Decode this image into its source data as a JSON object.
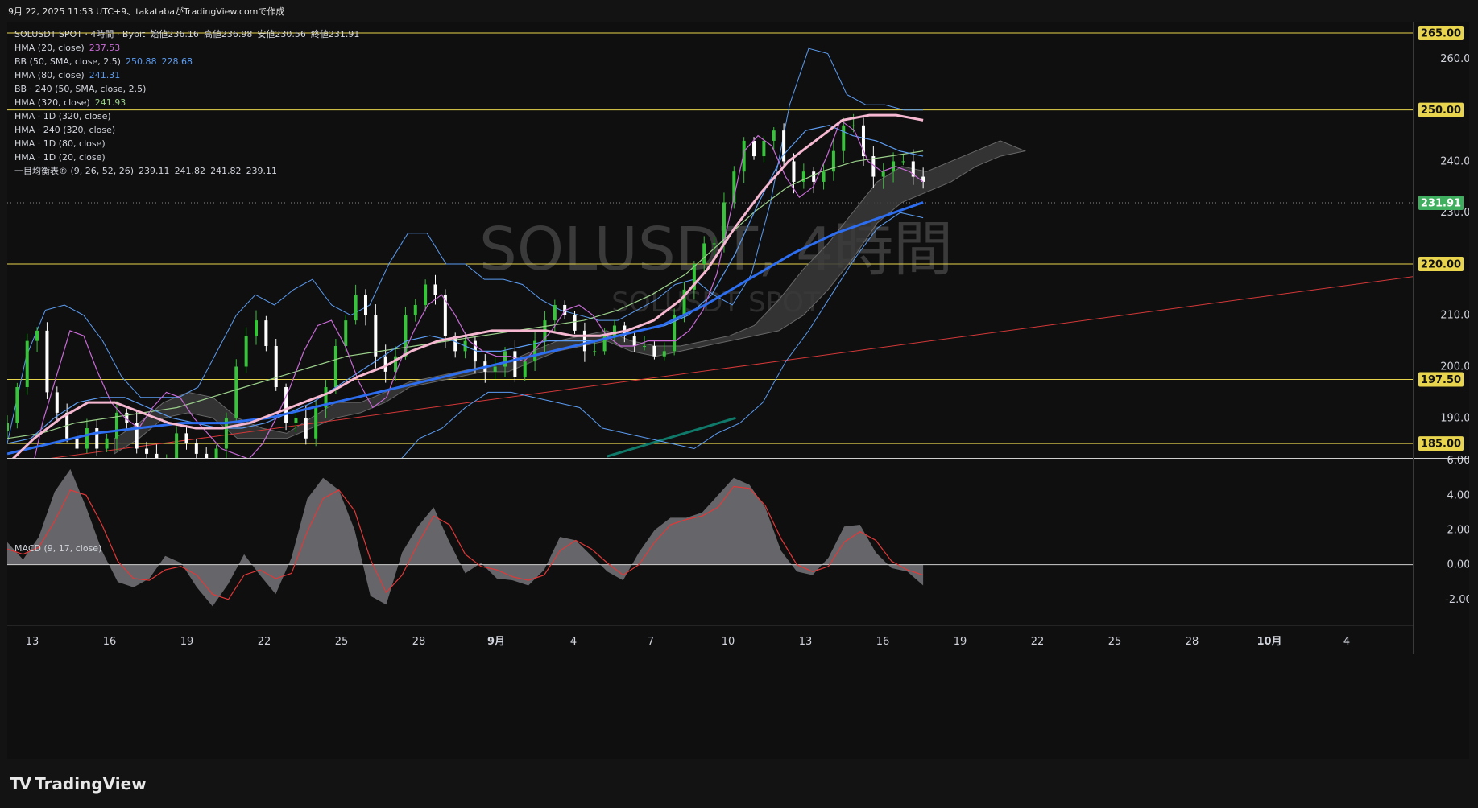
{
  "caption": "9月 22, 2025 11:53 UTC+9、takatabaがTradingView.comで作成",
  "watermark": {
    "main": "SOLUSDT, 4時間",
    "sub": "SOLUSDT SPOT"
  },
  "footer_brand": "TradingView",
  "macd_title": "MACD (9, 17, close)",
  "legend": [
    {
      "label": "SOLUSDT SPOT · 4時間 · Bybit",
      "values": [
        "始値236.16",
        "高値236.98",
        "安値230.56",
        "終値231.91"
      ],
      "color": "#d1d4dc"
    },
    {
      "label": "HMA (20, close)",
      "values": [
        "237.53"
      ],
      "color": "#c86ad6"
    },
    {
      "label": "BB (50, SMA, close, 2.5)",
      "values": [
        "250.88",
        "228.68"
      ],
      "color": "#5b9cf2"
    },
    {
      "label": "HMA (80, close)",
      "values": [
        "241.31"
      ],
      "color": "#5b9cf2"
    },
    {
      "label": "BB · 240 (50, SMA, close, 2.5)",
      "values": [],
      "color": "#d1d4dc"
    },
    {
      "label": "HMA (320, close)",
      "values": [
        "241.93"
      ],
      "color": "#9bd18b"
    },
    {
      "label": "HMA · 1D (320, close)",
      "values": [],
      "color": "#d1d4dc"
    },
    {
      "label": "HMA · 240 (320, close)",
      "values": [],
      "color": "#d1d4dc"
    },
    {
      "label": "HMA · 1D (80, close)",
      "values": [],
      "color": "#d1d4dc"
    },
    {
      "label": "HMA · 1D (20, close)",
      "values": [],
      "color": "#d1d4dc"
    },
    {
      "label": "一目均衡表® (9, 26, 52, 26)",
      "values": [
        "239.11",
        "241.82",
        "241.82",
        "239.11"
      ],
      "color": "#d1d4dc"
    }
  ],
  "chart_data": [
    {
      "type": "line",
      "title": "",
      "price_axis_ticks": [
        260,
        240,
        230,
        210,
        200,
        190
      ],
      "price_labels": [
        {
          "value": 265,
          "text": "265.00",
          "kind": "level"
        },
        {
          "value": 250,
          "text": "250.00",
          "kind": "level"
        },
        {
          "value": 220,
          "text": "220.00",
          "kind": "level"
        },
        {
          "value": 197.5,
          "text": "197.50",
          "kind": "level"
        },
        {
          "value": 185,
          "text": "185.00",
          "kind": "level"
        },
        {
          "value": 231.91,
          "text": "231.91",
          "kind": "last"
        }
      ],
      "ylim": [
        182.2,
        267.2
      ],
      "x_ticks": [
        "13",
        "16",
        "19",
        "22",
        "25",
        "28",
        "9月",
        "4",
        "7",
        "10",
        "13",
        "16",
        "19",
        "22",
        "25",
        "28",
        "10月",
        "4"
      ],
      "colors": {
        "level": "#e8d44d",
        "last": "#3fae5e",
        "up": "#37c43a",
        "down": "#ffffff",
        "bb": "#5b9cf2",
        "hma20": "#c86ad6",
        "hma80": "#5b9cf2",
        "hma320": "#9bd18b",
        "hma_1d_20": "#f5b8d0",
        "hma_1d_80": "#2d6df0",
        "cloud": "#777777",
        "trend": "#d43838",
        "teal": "#0f7a6a"
      },
      "close": [
        189,
        196,
        205,
        207,
        195,
        191,
        186,
        184,
        188,
        184,
        186,
        191,
        189,
        184,
        183,
        181,
        182,
        187,
        185,
        183,
        181,
        184,
        190,
        200,
        206,
        209,
        204,
        196,
        189,
        190,
        186,
        192,
        196,
        204,
        209,
        214,
        210,
        202,
        199,
        202,
        210,
        212,
        216,
        214,
        206,
        203,
        205,
        201,
        199,
        200,
        203,
        198,
        201,
        205,
        209,
        212,
        210,
        207,
        203,
        203,
        206,
        208,
        206,
        204,
        204,
        202,
        203,
        210,
        215,
        220,
        224,
        224,
        232,
        238,
        244,
        241,
        244,
        246,
        240,
        236,
        238,
        236,
        238,
        242,
        247,
        247,
        241,
        237,
        238,
        240,
        240,
        237,
        236
      ],
      "bb_upper": [
        185,
        202,
        211,
        212,
        210,
        205,
        198,
        194,
        194,
        194,
        196,
        203,
        210,
        214,
        212,
        215,
        217,
        212,
        210,
        212,
        220,
        226,
        226,
        220,
        220,
        217,
        217,
        216,
        213,
        211,
        210,
        209,
        209,
        211,
        213,
        216,
        217,
        214,
        212,
        218,
        232,
        251,
        262,
        261,
        253,
        251,
        251,
        250,
        250
      ],
      "bb_lower": [
        177,
        178,
        180,
        179,
        181,
        181,
        180,
        179,
        177,
        175,
        172,
        172,
        171,
        173,
        175,
        178,
        180,
        181,
        186,
        188,
        192,
        195,
        195,
        194,
        193,
        192,
        188,
        187,
        186,
        185,
        184,
        187,
        189,
        193,
        201,
        207,
        214,
        221,
        227,
        230,
        229
      ],
      "hma20": [
        177,
        189,
        198,
        207,
        206,
        199,
        193,
        190,
        188,
        192,
        195,
        194,
        190,
        187,
        184,
        183,
        182,
        185,
        190,
        196,
        203,
        208,
        209,
        204,
        197,
        192,
        194,
        201,
        207,
        212,
        214,
        210,
        205,
        203,
        202,
        202,
        201,
        204,
        207,
        211,
        212,
        210,
        206,
        204,
        204,
        205,
        205,
        205,
        207,
        211,
        218,
        230,
        242,
        245,
        243,
        237,
        233,
        235,
        241,
        248,
        246,
        240,
        238,
        239,
        238,
        236
      ],
      "hma80": [
        185,
        186,
        190,
        193,
        194,
        194,
        192,
        190,
        189,
        188,
        188,
        189,
        191,
        193,
        196,
        199,
        202,
        205,
        206,
        205,
        203,
        203,
        204,
        205,
        205,
        205,
        206,
        207,
        208,
        210,
        214,
        222,
        232,
        241,
        246,
        247,
        245,
        244,
        242,
        241
      ],
      "hma320": [
        186,
        187,
        189,
        190,
        191,
        192,
        194,
        196,
        198,
        200,
        202,
        203,
        204,
        205,
        206,
        207,
        208,
        209,
        211,
        214,
        218,
        224,
        230,
        235,
        238,
        240,
        241,
        242
      ],
      "hma_1d_20": [
        181,
        186,
        190,
        193,
        193,
        191,
        189,
        188,
        188,
        189,
        191,
        193,
        195,
        198,
        200,
        203,
        205,
        206,
        207,
        207,
        207,
        206,
        206,
        207,
        209,
        213,
        219,
        227,
        234,
        240,
        244,
        248,
        249,
        249,
        248
      ],
      "hma_1d_80": [
        183,
        185,
        187,
        188,
        189,
        189,
        190,
        192,
        194,
        196,
        198,
        200,
        202,
        204,
        206,
        208,
        212,
        217,
        222,
        226,
        229,
        232
      ],
      "cloud_a": [
        186,
        189,
        193,
        195,
        194,
        190,
        188,
        187,
        190,
        193,
        193,
        195,
        197,
        198,
        199,
        200,
        201,
        203,
        205,
        206,
        207,
        205,
        204,
        204,
        205,
        206,
        208,
        213,
        219,
        224,
        230,
        236,
        239,
        238,
        240,
        242,
        244,
        242
      ],
      "cloud_b": [
        183,
        186,
        190,
        191,
        190,
        186,
        186,
        186,
        188,
        190,
        191,
        193,
        196,
        197,
        198,
        199,
        199,
        201,
        203,
        204,
        205,
        203,
        202,
        203,
        204,
        205,
        206,
        207,
        210,
        215,
        221,
        228,
        232,
        234,
        236,
        239,
        241,
        242
      ],
      "trend": [
        [
          0,
          181
        ],
        [
          1.76,
          230
        ]
      ],
      "teal": [
        [
          0.56,
          182.5
        ],
        [
          0.68,
          190
        ]
      ]
    },
    {
      "type": "area",
      "title": "MACD (9, 17, close)",
      "y_ticks": [
        6,
        4,
        2,
        0,
        -2
      ],
      "ylim": [
        -3.4,
        6.1
      ],
      "colors": {
        "macd_fill": "#707074",
        "signal": "#e23838",
        "zero": "#cfcfcf"
      },
      "macd": [
        1.3,
        0.3,
        1.6,
        4.2,
        5.5,
        3.3,
        0.8,
        -1.0,
        -1.3,
        -0.8,
        0.5,
        0.1,
        -1.3,
        -2.4,
        -1.1,
        0.6,
        -0.6,
        -1.7,
        0.4,
        3.8,
        5.0,
        4.3,
        2.0,
        -1.8,
        -2.3,
        0.7,
        2.2,
        3.3,
        1.3,
        -0.5,
        0.1,
        -0.8,
        -0.9,
        -1.2,
        -0.3,
        1.6,
        1.4,
        0.5,
        -0.4,
        -0.9,
        0.7,
        2.0,
        2.7,
        2.7,
        3.0,
        4.0,
        5.0,
        4.6,
        3.3,
        0.8,
        -0.4,
        -0.6,
        0.4,
        2.2,
        2.3,
        0.7,
        -0.2,
        -0.4,
        -1.2
      ],
      "signal": [
        0.9,
        0.6,
        1.0,
        2.5,
        4.3,
        4.0,
        2.3,
        0.2,
        -0.8,
        -0.9,
        -0.3,
        -0.1,
        -0.6,
        -1.7,
        -2.0,
        -0.6,
        -0.3,
        -0.8,
        -0.5,
        1.9,
        3.8,
        4.3,
        3.1,
        0.3,
        -1.6,
        -0.6,
        1.2,
        2.8,
        2.3,
        0.6,
        -0.1,
        -0.3,
        -0.7,
        -0.9,
        -0.6,
        0.8,
        1.4,
        0.9,
        0.1,
        -0.6,
        0.0,
        1.3,
        2.3,
        2.6,
        2.8,
        3.3,
        4.5,
        4.4,
        3.4,
        1.5,
        0.0,
        -0.4,
        -0.1,
        1.3,
        1.9,
        1.4,
        0.2,
        -0.3,
        -0.6
      ]
    }
  ]
}
